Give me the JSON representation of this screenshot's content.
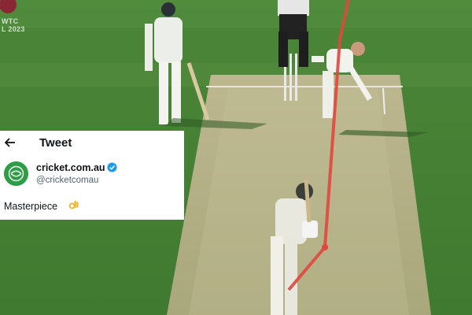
{
  "broadcast": {
    "logo_line1": "WTC",
    "logo_line2": "L 2023"
  },
  "tweet": {
    "header_title": "Tweet",
    "back_icon": "arrow-left-icon",
    "account_name": "cricket.com.au",
    "account_handle": "@cricketcomau",
    "verified_icon": "verified-badge-icon",
    "verified_color": "#1d9bf0",
    "avatar_icon": "cricket-com-au-logo",
    "avatar_color": "#2e9e46",
    "text": "Masterpiece",
    "emoji_icon": "ok-hand-icon"
  },
  "colors": {
    "field": "#4f8a3a",
    "pitch": "#b9b58d",
    "tracking_line": "#e0473d"
  }
}
